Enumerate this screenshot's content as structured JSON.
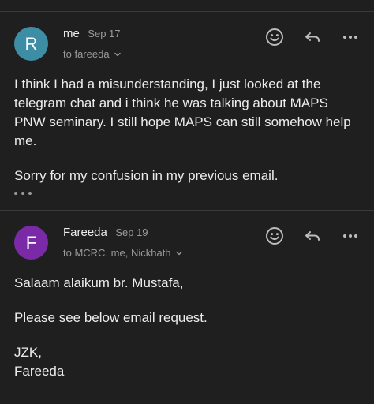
{
  "colors": {
    "background": "#1f1f1f",
    "avatar_me": "#3d8ea4",
    "avatar_fareeda": "#7b2aa7",
    "icon": "#bdbdbd",
    "secondary_text": "#9a9a9a"
  },
  "messages": [
    {
      "avatar_letter": "R",
      "sender": "me",
      "date": "Sep 17",
      "recipients": "to fareeda",
      "body": [
        "I think I had a misunderstanding, I just looked at the telegram chat and i think he was talking about MAPS PNW seminary. I still hope MAPS can still somehow help me.",
        "Sorry for my confusion in my previous email."
      ],
      "icons": [
        "emoji-reaction-icon",
        "reply-icon",
        "more-options-icon"
      ],
      "show_trimmed_content": true
    },
    {
      "avatar_letter": "F",
      "sender": "Fareeda",
      "date": "Sep 19",
      "recipients": "to MCRC, me, Nickhath",
      "body": [
        "Salaam alaikum br. Mustafa,",
        "Please see below email request.",
        "JZK,",
        "Fareeda"
      ],
      "icons": [
        "emoji-reaction-icon",
        "reply-icon",
        "more-options-icon"
      ]
    }
  ]
}
